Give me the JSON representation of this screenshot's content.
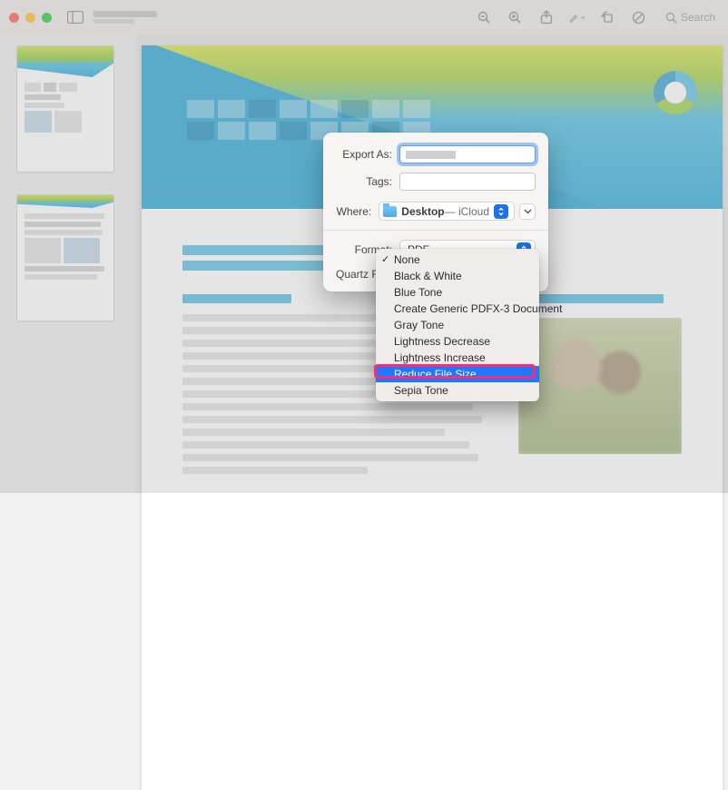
{
  "toolbar": {
    "search_placeholder": "Search"
  },
  "sheet": {
    "export_as_label": "Export As:",
    "tags_label": "Tags:",
    "where_label": "Where:",
    "where_value_prefix": "Desktop",
    "where_value_suffix": " — iCloud",
    "format_label": "Format:",
    "format_value": "PDF",
    "quartz_filter_label": "Quartz Filter"
  },
  "menu": {
    "selected_index": 7,
    "checked_index": 0,
    "items": [
      "None",
      "Black & White",
      "Blue Tone",
      "Create Generic PDFX-3 Document",
      "Gray Tone",
      "Lightness Decrease",
      "Lightness Increase",
      "Reduce File Size",
      "Sepia Tone"
    ]
  }
}
